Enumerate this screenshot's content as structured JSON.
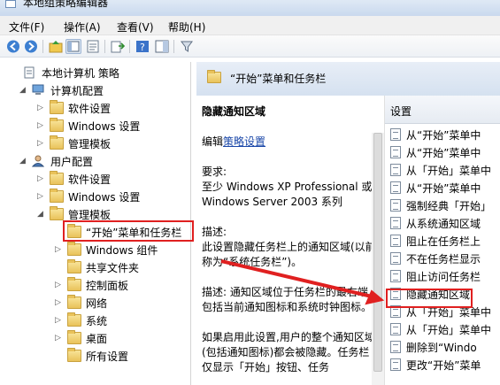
{
  "window": {
    "title": "本地组策略编辑器"
  },
  "menu": [
    "文件(F)",
    "操作(A)",
    "查看(V)",
    "帮助(H)"
  ],
  "tree": [
    {
      "label": "本地计算机 策略",
      "indent": 0,
      "arrow": "",
      "icon": "policy"
    },
    {
      "label": "计算机配置",
      "indent": 1,
      "arrow": "◢",
      "icon": "computer"
    },
    {
      "label": "软件设置",
      "indent": 2,
      "arrow": "▷",
      "icon": "folder"
    },
    {
      "label": "Windows 设置",
      "indent": 2,
      "arrow": "▷",
      "icon": "folder"
    },
    {
      "label": "管理模板",
      "indent": 2,
      "arrow": "▷",
      "icon": "folder"
    },
    {
      "label": "用户配置",
      "indent": 1,
      "arrow": "◢",
      "icon": "user"
    },
    {
      "label": "软件设置",
      "indent": 2,
      "arrow": "▷",
      "icon": "folder"
    },
    {
      "label": "Windows 设置",
      "indent": 2,
      "arrow": "▷",
      "icon": "folder"
    },
    {
      "label": "管理模板",
      "indent": 2,
      "arrow": "◢",
      "icon": "folder"
    },
    {
      "label": "“开始”菜单和任务栏",
      "indent": 3,
      "arrow": "",
      "icon": "folder"
    },
    {
      "label": "Windows 组件",
      "indent": 3,
      "arrow": "▷",
      "icon": "folder"
    },
    {
      "label": "共享文件夹",
      "indent": 3,
      "arrow": "",
      "icon": "folder"
    },
    {
      "label": "控制面板",
      "indent": 3,
      "arrow": "▷",
      "icon": "folder"
    },
    {
      "label": "网络",
      "indent": 3,
      "arrow": "▷",
      "icon": "folder"
    },
    {
      "label": "系统",
      "indent": 3,
      "arrow": "▷",
      "icon": "folder"
    },
    {
      "label": "桌面",
      "indent": 3,
      "arrow": "▷",
      "icon": "folder"
    },
    {
      "label": "所有设置",
      "indent": 3,
      "arrow": "",
      "icon": "folder"
    }
  ],
  "right": {
    "header_title": "“开始”菜单和任务栏",
    "setting_name": "隐藏通知区域",
    "edit_prefix": "编辑",
    "edit_link": "策略设置",
    "requirements_label": "要求:",
    "requirements_text": "至少 Windows XP Professional 或 Windows Server 2003 系列",
    "description_label": "描述:",
    "description_text": "此设置隐藏任务栏上的通知区域(以前称为“系统任务栏”)。",
    "detail_text": "描述: 通知区域位于任务栏的最右端,包括当前通知图标和系统时钟图标。",
    "more_text": "如果启用此设置,用户的整个通知区域(包括通知图标)都会被隐藏。任务栏仅显示「开始」按钮、任务"
  },
  "list": {
    "column": "设置",
    "items": [
      "从“开始”菜单中",
      "从“开始”菜单中",
      "从「开始」菜单中",
      "从“开始”菜单中",
      "强制经典「开始」",
      "从系统通知区域",
      "阻止在任务栏上",
      "不在任务栏显示",
      "阻止访问任务栏",
      "隐藏通知区域",
      "从「开始」菜单中",
      "从「开始」菜单中",
      "删除到“Windo",
      "更改“开始”菜单"
    ]
  }
}
